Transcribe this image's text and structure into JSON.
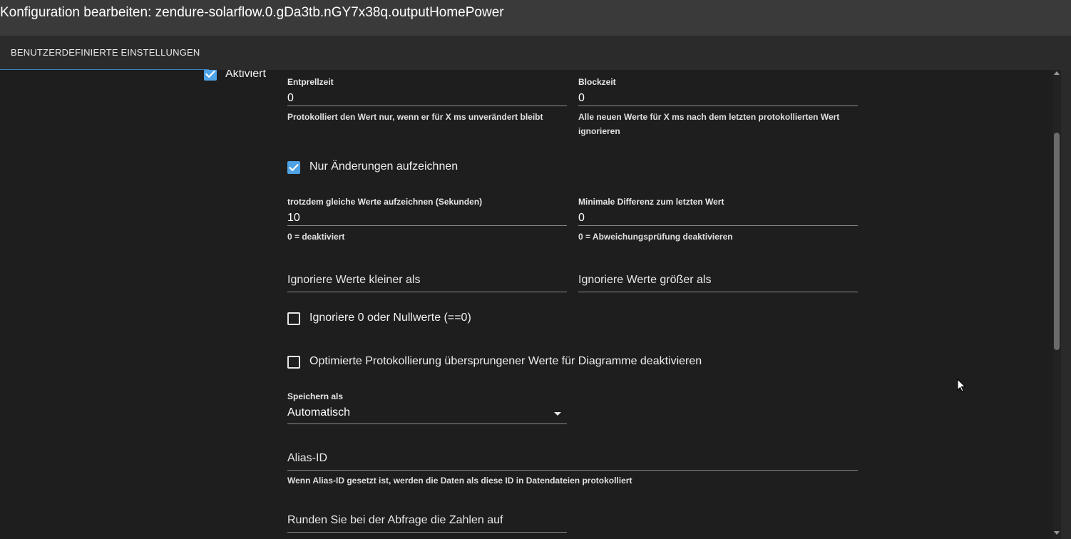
{
  "window": {
    "title": "Konfiguration bearbeiten: zendure-solarflow.0.gDa3tb.nGY7x38q.outputHomePower"
  },
  "tabs": [
    {
      "label": "BENUTZERDEFINIERTE EINSTELLUNGEN",
      "active": true
    }
  ],
  "form": {
    "enabled": {
      "label": "Aktiviert",
      "checked": true
    },
    "debounce": {
      "label": "Entprellzeit",
      "value": "0",
      "helper": "Protokolliert den Wert nur, wenn er für X ms unverändert bleibt"
    },
    "blocktime": {
      "label": "Blockzeit",
      "value": "0",
      "helper": "Alle neuen Werte für X ms nach dem letzten protokollierten Wert ignorieren"
    },
    "changes_only": {
      "label": "Nur Änderungen aufzeichnen",
      "checked": true
    },
    "changes_relog": {
      "label": "trotzdem gleiche Werte aufzeichnen (Sekunden)",
      "value": "10",
      "helper": "0 = deaktiviert"
    },
    "changes_min_delta": {
      "label": "Minimale Differenz zum letzten Wert",
      "value": "0",
      "helper": "0 = Abweichungsprüfung deaktivieren"
    },
    "ignore_below": {
      "label": "Ignoriere Werte kleiner als",
      "value": ""
    },
    "ignore_above": {
      "label": "Ignoriere Werte größer als",
      "value": ""
    },
    "ignore_zero": {
      "label": "Ignoriere 0 oder Nullwerte (==0)",
      "checked": false
    },
    "disable_skipped": {
      "label": "Optimierte Protokollierung übersprungener Werte für Diagramme deaktivieren",
      "checked": false
    },
    "store_as": {
      "label": "Speichern als",
      "value": "Automatisch"
    },
    "alias_id": {
      "label": "Alias-ID",
      "value": "",
      "helper": "Wenn Alias-ID gesetzt ist, werden die Daten als diese ID in Datendateien protokolliert"
    },
    "round": {
      "label": "Runden Sie bei der Abfrage die Zahlen auf",
      "value": ""
    }
  },
  "colors": {
    "accent": "#4ea2e6",
    "tab_indicator": "#3d7fc0",
    "background": "#1e1e1e",
    "titlebar": "#3a3a3a"
  }
}
